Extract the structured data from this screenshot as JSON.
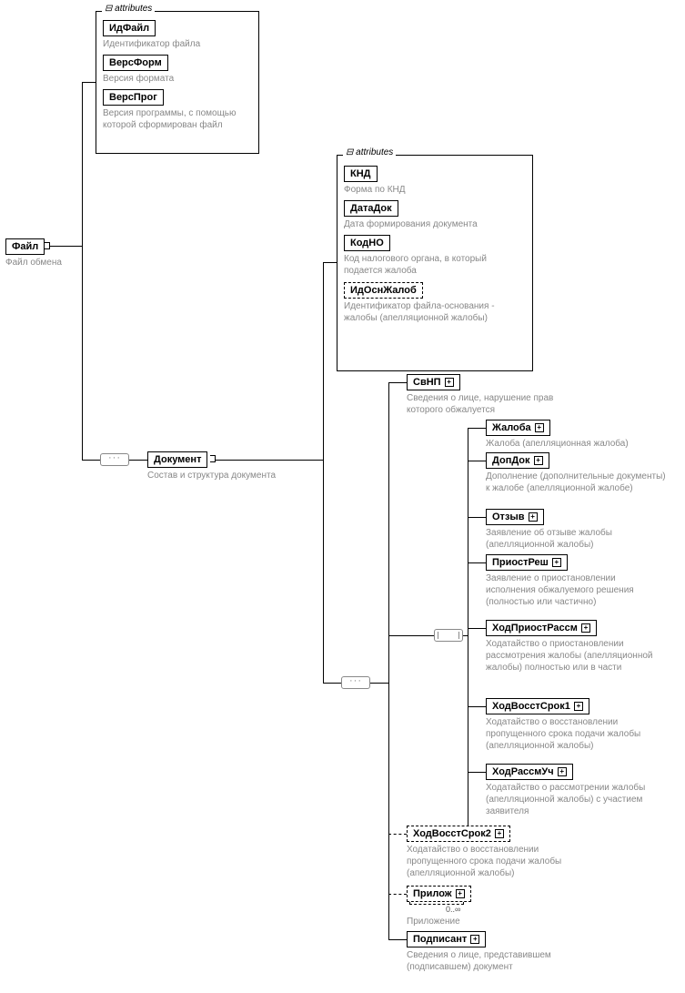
{
  "attrs_label": "attributes",
  "root": {
    "name": "Файл",
    "desc": "Файл обмена"
  },
  "root_attrs": [
    {
      "name": "ИдФайл",
      "desc": "Идентификатор файла"
    },
    {
      "name": "ВерсФорм",
      "desc": "Версия формата"
    },
    {
      "name": "ВерсПрог",
      "desc": "Версия программы, с помощью которой сформирован файл"
    }
  ],
  "doc": {
    "name": "Документ",
    "desc": "Состав и структура документа"
  },
  "doc_attrs": [
    {
      "name": "КНД",
      "desc": "Форма по КНД"
    },
    {
      "name": "ДатаДок",
      "desc": "Дата формирования документа"
    },
    {
      "name": "КодНО",
      "desc": "Код налогового органа, в который подается жалоба"
    },
    {
      "name": "ИдОснЖалоб",
      "desc": "Идентификатор файла-основания - жалобы (апелляционной жалобы)",
      "dashed": true
    }
  ],
  "svnp": {
    "name": "СвНП",
    "desc": "Сведения о лице, нарушение прав которого обжалуется"
  },
  "choice_items": [
    {
      "name": "Жалоба",
      "desc": "Жалоба (апелляционная жалоба)"
    },
    {
      "name": "ДопДок",
      "desc": "Дополнение (дополнительные документы) к жалобе (апелляционной жалобе)"
    },
    {
      "name": "Отзыв",
      "desc": "Заявление об отзыве жалобы (апелляционной жалобы)"
    },
    {
      "name": "ПриостРеш",
      "desc": "Заявление о приостановлении исполнения обжалуемого решения (полностью или частично)"
    },
    {
      "name": "ХодПриостРассм",
      "desc": "Ходатайство о приостановлении рассмотрения жалобы (апелляционной жалобы) полностью или в части"
    },
    {
      "name": "ХодВосстСрок1",
      "desc": "Ходатайство о восстановлении пропущенного срока подачи жалобы (апелляционной жалобы)"
    },
    {
      "name": "ХодРассмУч",
      "desc": "Ходатайство о рассмотрении жалобы (апелляционной жалобы) с участием заявителя"
    }
  ],
  "hod2": {
    "name": "ХодВосстСрок2",
    "desc": "Ходатайство о восстановлении пропущенного срока подачи жалобы (апелляционной жалобы)",
    "dashed": true
  },
  "priloz": {
    "name": "Прилож",
    "desc": "Приложение",
    "dashed": true,
    "occurs": "0..∞"
  },
  "podpisant": {
    "name": "Подписант",
    "desc": "Сведения о лице, представившем (подписавшем) документ"
  }
}
